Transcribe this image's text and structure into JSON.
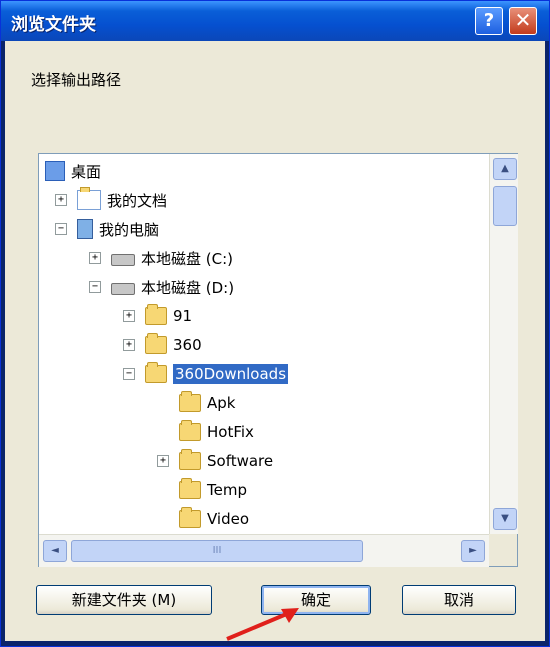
{
  "window": {
    "title": "浏览文件夹",
    "help_label": "?",
    "close_label": "✕"
  },
  "prompt": "选择输出路径",
  "tree": [
    {
      "label": "桌面",
      "icon": "desktop-icon",
      "expander": "none",
      "selected": false
    },
    {
      "label": "我的文档",
      "icon": "my-documents-icon",
      "expander": "+",
      "selected": false
    },
    {
      "label": "我的电脑",
      "icon": "my-computer-icon",
      "expander": "−",
      "selected": false
    },
    {
      "label": "本地磁盘 (C:)",
      "icon": "hard-disk-icon",
      "expander": "+",
      "selected": false
    },
    {
      "label": "本地磁盘 (D:)",
      "icon": "hard-disk-icon",
      "expander": "−",
      "selected": false
    },
    {
      "label": "91",
      "icon": "folder-icon",
      "expander": "+",
      "selected": false
    },
    {
      "label": "360",
      "icon": "folder-icon",
      "expander": "+",
      "selected": false
    },
    {
      "label": "360Downloads",
      "icon": "folder-icon",
      "expander": "−",
      "selected": true
    },
    {
      "label": "Apk",
      "icon": "folder-icon",
      "expander": "none",
      "selected": false
    },
    {
      "label": "HotFix",
      "icon": "folder-icon",
      "expander": "none",
      "selected": false
    },
    {
      "label": "Software",
      "icon": "folder-icon",
      "expander": "+",
      "selected": false
    },
    {
      "label": "Temp",
      "icon": "folder-icon",
      "expander": "none",
      "selected": false
    },
    {
      "label": "Video",
      "icon": "folder-icon",
      "expander": "none",
      "selected": false
    }
  ],
  "scroll": {
    "up": "▲",
    "down": "▼",
    "left": "◄",
    "right": "►",
    "grip": "III"
  },
  "buttons": {
    "new_folder": "新建文件夹 (M)",
    "ok": "确定",
    "cancel": "取消"
  },
  "colors": {
    "title_bar": "#0a5fd8",
    "selection": "#316ac5",
    "face": "#ece9d8",
    "annotation_arrow": "#e0201b"
  }
}
